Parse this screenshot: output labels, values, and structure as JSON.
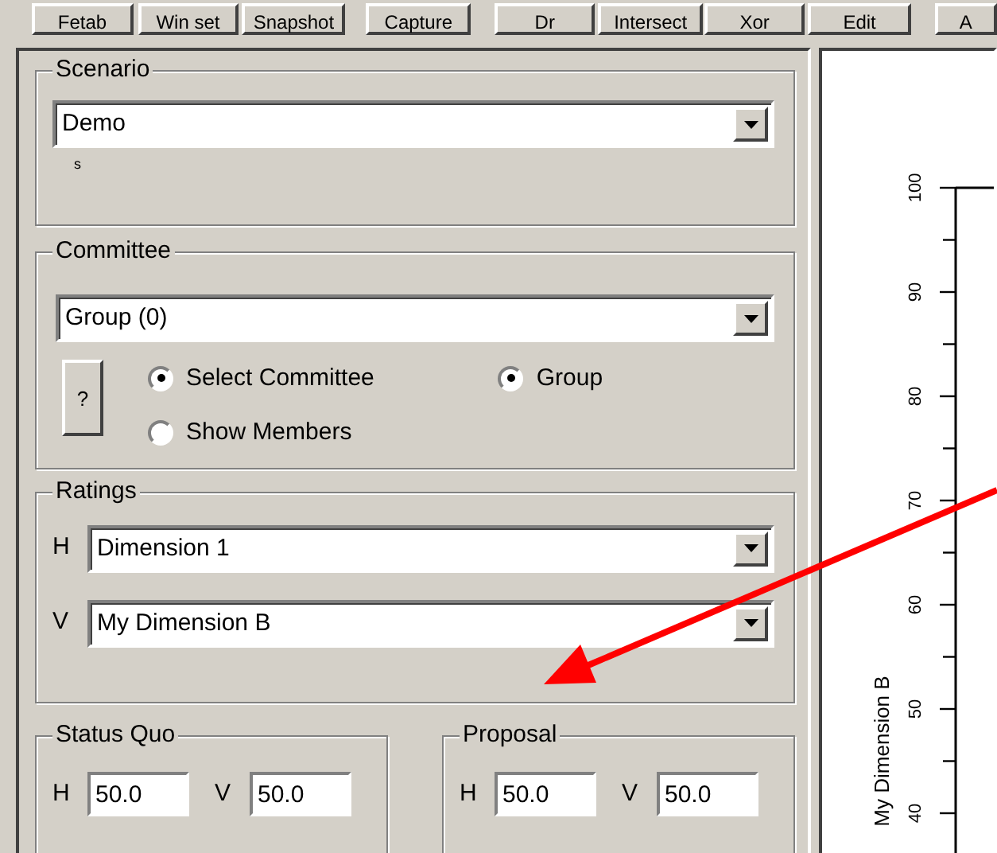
{
  "toolbar": {
    "buttons": [
      "Fetab",
      "Win set",
      "Snapshot",
      "Capture",
      "Dr",
      "Intersect",
      "Xor",
      "Edit",
      "A"
    ]
  },
  "scenario": {
    "title": "Scenario",
    "value": "Demo",
    "note": "s"
  },
  "committee": {
    "title": "Committee",
    "value": "Group (0)",
    "help_button": "?",
    "modes": [
      {
        "label": "Select Committee",
        "selected": true
      },
      {
        "label": "Show Members",
        "selected": false
      }
    ],
    "group_option": {
      "label": "Group",
      "checked": true
    }
  },
  "ratings": {
    "title": "Ratings",
    "rows": [
      {
        "axis": "H",
        "value": "Dimension 1"
      },
      {
        "axis": "V",
        "value": "My Dimension B"
      }
    ]
  },
  "status_quo": {
    "title": "Status Quo",
    "fields": [
      {
        "axis": "H",
        "value": "50.0"
      },
      {
        "axis": "V",
        "value": "50.0"
      }
    ]
  },
  "proposal": {
    "title": "Proposal",
    "fields": [
      {
        "axis": "H",
        "value": "50.0"
      },
      {
        "axis": "V",
        "value": "50.0"
      }
    ]
  },
  "plot": {
    "axis_title": "My Dimension B",
    "tick_labels": [
      "100",
      "90",
      "80",
      "70",
      "60",
      "50",
      "40"
    ]
  }
}
